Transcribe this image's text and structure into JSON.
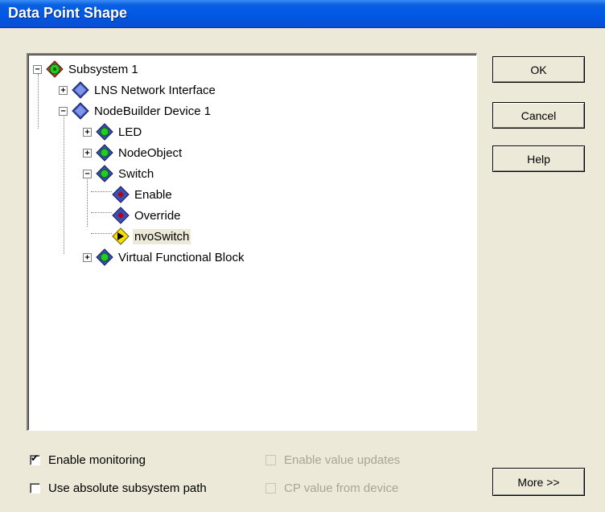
{
  "window": {
    "title": "Data Point Shape"
  },
  "tree": {
    "root": "Subsystem 1",
    "lns": "LNS Network Interface",
    "device": "NodeBuilder Device 1",
    "led": "LED",
    "nodeobject": "NodeObject",
    "switch": "Switch",
    "enable": "Enable",
    "override": "Override",
    "nvoswitch": "nvoSwitch",
    "vfb": "Virtual Functional Block",
    "selected": "nvoSwitch"
  },
  "buttons": {
    "ok": "OK",
    "cancel": "Cancel",
    "help": "Help",
    "more": "More >>"
  },
  "options": {
    "enable_monitoring": {
      "label": "Enable monitoring",
      "checked": true,
      "enabled": true
    },
    "absolute_path": {
      "label": "Use absolute subsystem path",
      "checked": false,
      "enabled": true
    },
    "value_updates": {
      "label": "Enable value updates",
      "checked": false,
      "enabled": false
    },
    "cp_from_device": {
      "label": "CP value from device",
      "checked": false,
      "enabled": false
    }
  },
  "colors": {
    "titlebar": "#0058e6",
    "dialog_bg": "#ece9d8",
    "node_green": "#22cc22",
    "node_blue": "#3b4fb8",
    "item_red": "#c00000",
    "item_yellow": "#f5e000"
  }
}
